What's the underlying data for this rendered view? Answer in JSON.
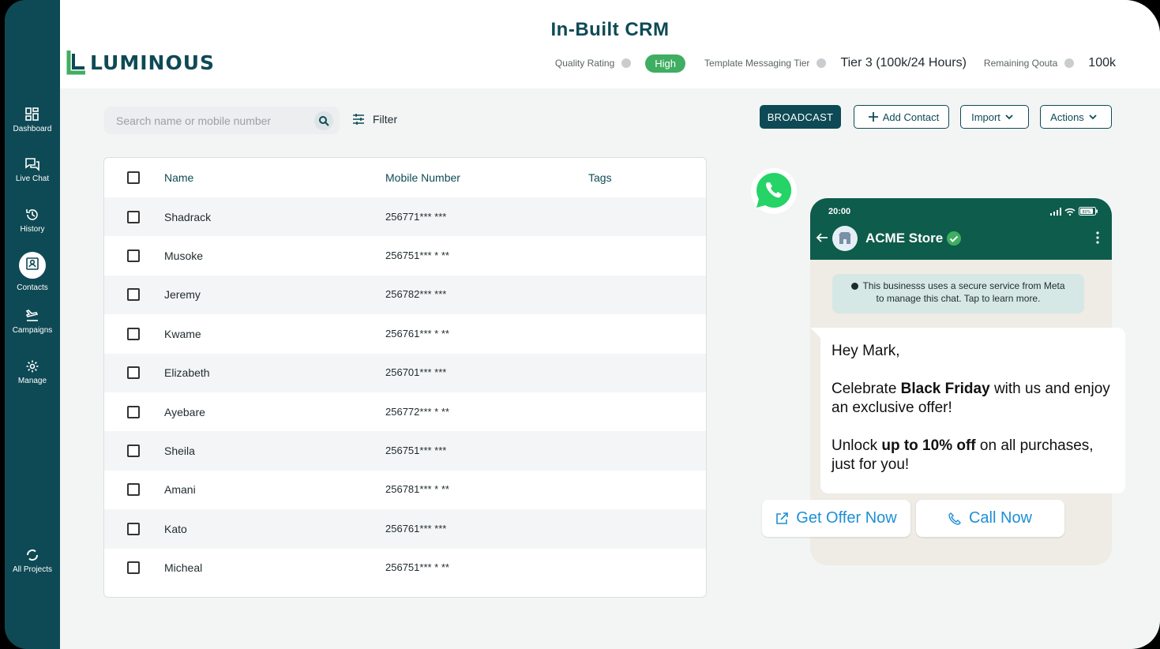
{
  "header": {
    "title": "In-Built CRM",
    "logo_text": "LUMINOUS",
    "quality_label": "Quality Rating",
    "quality_value": "High",
    "tier_label": "Template Messaging Tier",
    "tier_value": "Tier 3 (100k/24 Hours)",
    "quota_label": "Remaining Qouta",
    "quota_value": "100k"
  },
  "sidebar": {
    "items": [
      {
        "label": "Dashboard",
        "icon": "dashboard-icon"
      },
      {
        "label": "Live Chat",
        "icon": "chat-icon"
      },
      {
        "label": "History",
        "icon": "history-icon"
      },
      {
        "label": "Contacts",
        "icon": "contacts-icon",
        "active": true
      },
      {
        "label": "Campaigns",
        "icon": "plane-icon"
      },
      {
        "label": "Manage",
        "icon": "gear-icon"
      }
    ],
    "bottom": {
      "label": "All Projects",
      "icon": "refresh-icon"
    }
  },
  "toolbar": {
    "search_placeholder": "Search name or mobile number",
    "filter_label": "Filter",
    "broadcast_label": "BROADCAST",
    "add_contact_label": "Add Contact",
    "import_label": "Import",
    "actions_label": "Actions"
  },
  "table": {
    "columns": [
      "Name",
      "Mobile Number",
      "Tags"
    ],
    "rows": [
      {
        "name": "Shadrack",
        "mobile": "256771*** ***"
      },
      {
        "name": "Musoke",
        "mobile": "256751*** * **"
      },
      {
        "name": "Jeremy",
        "mobile": "256782*** ***"
      },
      {
        "name": "Kwame",
        "mobile": "256761*** * **"
      },
      {
        "name": "Elizabeth",
        "mobile": "256701*** ***"
      },
      {
        "name": "Ayebare",
        "mobile": "256772*** * **"
      },
      {
        "name": "Sheila",
        "mobile": "256751*** ***"
      },
      {
        "name": "Amani",
        "mobile": "256781*** * **"
      },
      {
        "name": "Kato",
        "mobile": "256761*** ***"
      },
      {
        "name": "Micheal",
        "mobile": "256751*** * **"
      }
    ]
  },
  "preview": {
    "time": "20:00",
    "battery": "80%",
    "store_name": "ACME Store",
    "notice": "This businesss uses a secure service from Meta to manage this chat. Tap to learn more.",
    "greeting": "Hey Mark,",
    "line1_pre": "Celebrate ",
    "line1_bold": "Black Friday",
    "line1_post": " with us and enjoy an exclusive offer!",
    "line2_pre": "Unlock ",
    "line2_bold": "up to 10% off",
    "line2_post": " on all purchases, just for you!",
    "cta_offer": "Get Offer Now",
    "cta_call": "Call Now"
  },
  "colors": {
    "brand": "#0e4a55",
    "badge_green": "#3fae62",
    "whatsapp_green": "#25d366",
    "link_blue": "#1e8fd6"
  }
}
